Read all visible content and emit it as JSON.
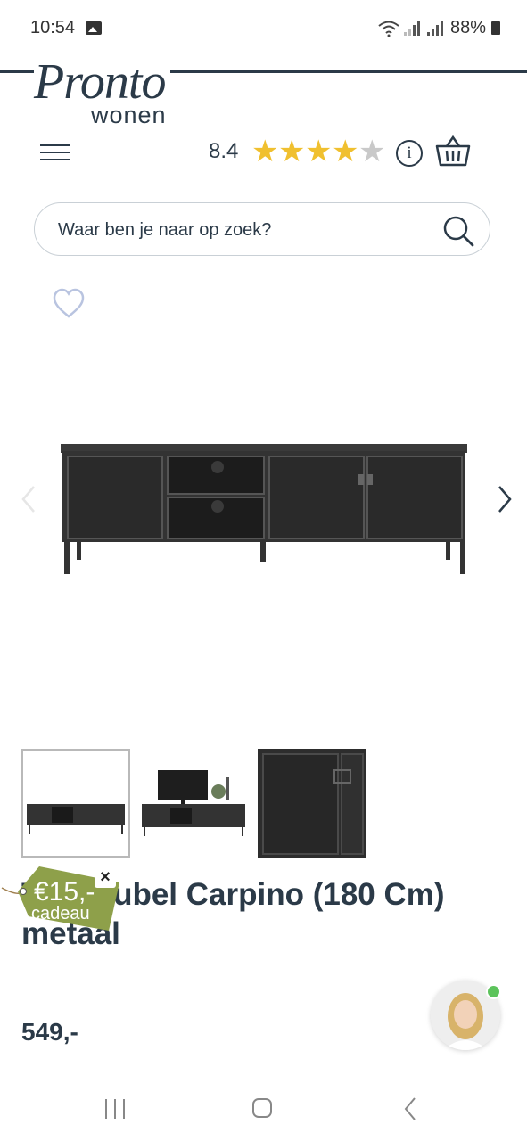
{
  "status_bar": {
    "time": "10:54",
    "battery": "88%"
  },
  "header": {
    "logo": "Pronto",
    "logo_sub": "wonen",
    "rating": "8.4",
    "stars": 4,
    "stars_max": 5,
    "info_glyph": "i"
  },
  "search": {
    "placeholder": "Waar ben je naar op zoek?"
  },
  "product": {
    "title": "Tv-meubel Carpino (180 Cm) metaal",
    "price": "549,-",
    "thumbnails": [
      "front-view",
      "styled-room",
      "detail-close-up"
    ]
  },
  "promo": {
    "amount": "€15,-",
    "label": "cadeau",
    "close": "×"
  },
  "colors": {
    "brand": "#2b3a48",
    "star": "#f0c02f",
    "promo": "#8ea04a",
    "online": "#5cc35b"
  },
  "icons": [
    "image-icon",
    "wifi-icon",
    "signal-icon",
    "battery-icon",
    "menu-icon",
    "star-icon",
    "info-icon",
    "basket-icon",
    "search-icon",
    "heart-icon",
    "chevron-left-icon",
    "chevron-right-icon",
    "close-icon",
    "recent-apps-icon",
    "home-icon",
    "back-icon"
  ]
}
